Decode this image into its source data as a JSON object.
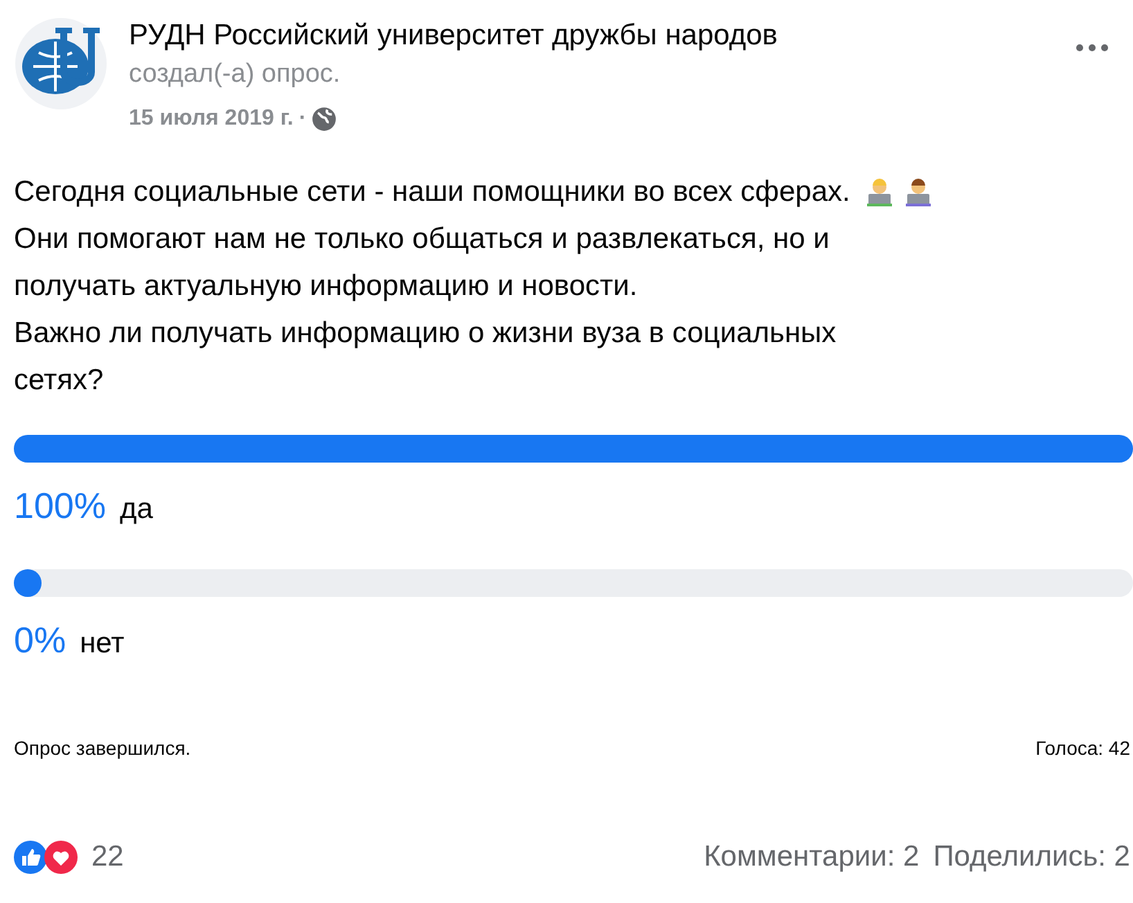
{
  "post": {
    "author": "РУДН Российский университет дружбы народов",
    "action": "создал(-а) опрос.",
    "date": "15 июля 2019 г.",
    "separator": "·"
  },
  "text_lines": [
    "Сегодня социальные сети - наши помощники во всех сферах.",
    "Они помогают нам не только общаться и развлекаться, но и",
    "получать актуальную информацию и новости.",
    "Важно ли получать информацию о жизни вуза в социальных",
    "сетях?"
  ],
  "poll": {
    "options": [
      {
        "percent": "100%",
        "label": "да",
        "level": 1
      },
      {
        "percent": "0%",
        "label": "нет",
        "level": 0
      }
    ],
    "status": "Опрос завершился.",
    "votes": "Голоса: 42"
  },
  "footer": {
    "reactions_count": "22",
    "comments": "Комментарии: 2",
    "shares": "Поделились: 2"
  }
}
